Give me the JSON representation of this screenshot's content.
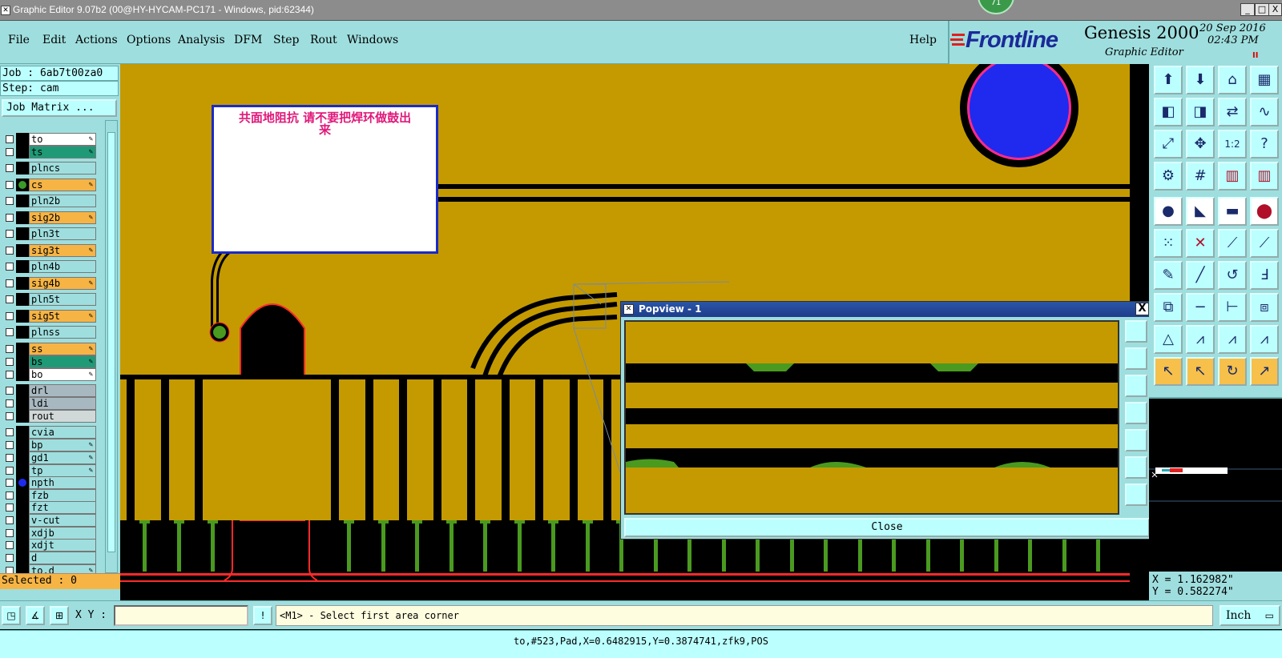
{
  "window": {
    "title": "Graphic Editor 9.07b2 (00@HY-HYCAM-PC171 - Windows, pid:62344)",
    "badge": "71",
    "minimize": "_",
    "maximize": "□",
    "close": "X"
  },
  "menu": [
    "File",
    "Edit",
    "Actions",
    "Options",
    "Analysis",
    "DFM",
    "Step",
    "Rout",
    "Windows"
  ],
  "help": "Help",
  "brand": {
    "logo": "Frontline",
    "product": "Genesis 2000",
    "subtitle": "Graphic Editor",
    "date": "20 Sep 2016",
    "time": "02:43 PM",
    "pause": "II"
  },
  "job": {
    "job_line": "Job : 6ab7t00za0",
    "step_line": "Step: cam",
    "matrix_button": "Job Matrix ..."
  },
  "layers": [
    {
      "name": "to",
      "color": "#ffffff",
      "pen": true,
      "dot": ""
    },
    {
      "name": "ts",
      "color": "#1e9a77",
      "pen": true,
      "dot": ""
    },
    {
      "name": "plncs",
      "color": "#9fdede",
      "pen": false,
      "dot": ""
    },
    {
      "name": "cs",
      "color": "#f6b445",
      "pen": true,
      "dot": "#3a9a2a"
    },
    {
      "name": "pln2b",
      "color": "#9fdede",
      "pen": false,
      "dot": ""
    },
    {
      "name": "sig2b",
      "color": "#f6b445",
      "pen": true,
      "dot": ""
    },
    {
      "name": "pln3t",
      "color": "#9fdede",
      "pen": false,
      "dot": ""
    },
    {
      "name": "sig3t",
      "color": "#f6b445",
      "pen": true,
      "dot": ""
    },
    {
      "name": "pln4b",
      "color": "#9fdede",
      "pen": false,
      "dot": ""
    },
    {
      "name": "sig4b",
      "color": "#f6b445",
      "pen": true,
      "dot": ""
    },
    {
      "name": "pln5t",
      "color": "#9fdede",
      "pen": false,
      "dot": ""
    },
    {
      "name": "sig5t",
      "color": "#f6b445",
      "pen": true,
      "dot": ""
    },
    {
      "name": "plnss",
      "color": "#9fdede",
      "pen": false,
      "dot": ""
    },
    {
      "name": "ss",
      "color": "#f6b445",
      "pen": true,
      "dot": ""
    },
    {
      "name": "bs",
      "color": "#1e9a77",
      "pen": true,
      "dot": ""
    },
    {
      "name": "bo",
      "color": "#ffffff",
      "pen": true,
      "dot": ""
    },
    {
      "name": "drl",
      "color": "#a8b8c0",
      "pen": false,
      "dot": ""
    },
    {
      "name": "ldi",
      "color": "#a8b8c0",
      "pen": false,
      "dot": ""
    },
    {
      "name": "rout",
      "color": "#d0d8d8",
      "pen": false,
      "dot": ""
    },
    {
      "name": "cvia",
      "color": "#9fdede",
      "pen": false,
      "dot": ""
    },
    {
      "name": "bp",
      "color": "#9fdede",
      "pen": true,
      "dot": ""
    },
    {
      "name": "gd1",
      "color": "#9fdede",
      "pen": true,
      "dot": ""
    },
    {
      "name": "tp",
      "color": "#9fdede",
      "pen": true,
      "dot": ""
    },
    {
      "name": "npth",
      "color": "#9fdede",
      "pen": false,
      "dot": "#1f2aee"
    },
    {
      "name": "fzb",
      "color": "#9fdede",
      "pen": false,
      "dot": ""
    },
    {
      "name": "fzt",
      "color": "#9fdede",
      "pen": false,
      "dot": ""
    },
    {
      "name": "v-cut",
      "color": "#9fdede",
      "pen": false,
      "dot": ""
    },
    {
      "name": "xdjb",
      "color": "#9fdede",
      "pen": false,
      "dot": ""
    },
    {
      "name": "xdjt",
      "color": "#9fdede",
      "pen": false,
      "dot": ""
    },
    {
      "name": "d",
      "color": "#9fdede",
      "pen": false,
      "dot": ""
    },
    {
      "name": "to.d",
      "color": "#9fdede",
      "pen": true,
      "dot": ""
    }
  ],
  "selected": "Selected : 0",
  "note": {
    "line1": "共面地阻抗    请不要把焊环做鼓出",
    "line2": "来"
  },
  "popview": {
    "title": "Popview - 1",
    "close_x": "X",
    "close_button": "Close"
  },
  "coords": {
    "x": "X = 1.162982\"",
    "y": "Y = 0.582274\""
  },
  "command": {
    "xy_label": "X Y :",
    "xy_value": "",
    "info_icon": "!",
    "prompt": "<M1> - Select first area corner",
    "unit": "Inch"
  },
  "status": "to,#523,Pad,X=0.6482915,Y=0.3874741,zfk9,POS",
  "colors": {
    "copper": "#c49a00",
    "copper_dark": "#b08a00",
    "substrate": "#000000",
    "finger": "#4a9a20",
    "highlight": "#ff2a2a",
    "ui_cyan": "#9fdede",
    "npth_blue": "#1f2aee"
  }
}
